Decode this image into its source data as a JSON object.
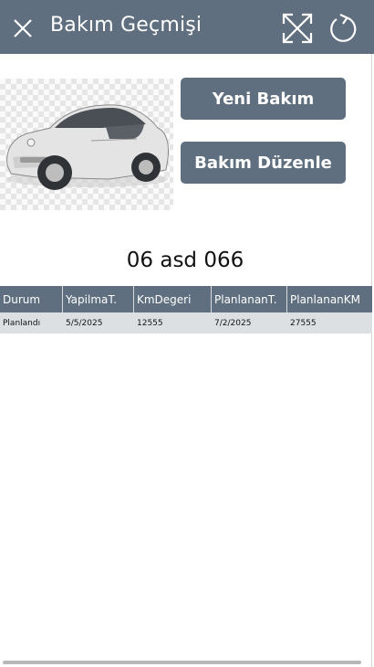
{
  "header": {
    "title": "Bakım Geçmişi",
    "background": "#5f6f7f",
    "icons": [
      "close-icon",
      "expand-icon",
      "refresh-icon"
    ]
  },
  "buttons": {
    "new_maintenance": "Yeni Bakım",
    "edit_maintenance": "Bakım Düzenle"
  },
  "vehicle": {
    "plate": "06 asd 066",
    "color": "#d9d9d9"
  },
  "table": {
    "columns": [
      "Durum",
      "YapilmaT.",
      "KmDegeri",
      "PlanlananT.",
      "PlanlananKM"
    ],
    "rows": [
      [
        "Planlandı",
        "5/5/2025",
        "12555",
        "7/2/2025",
        "27555"
      ]
    ]
  }
}
